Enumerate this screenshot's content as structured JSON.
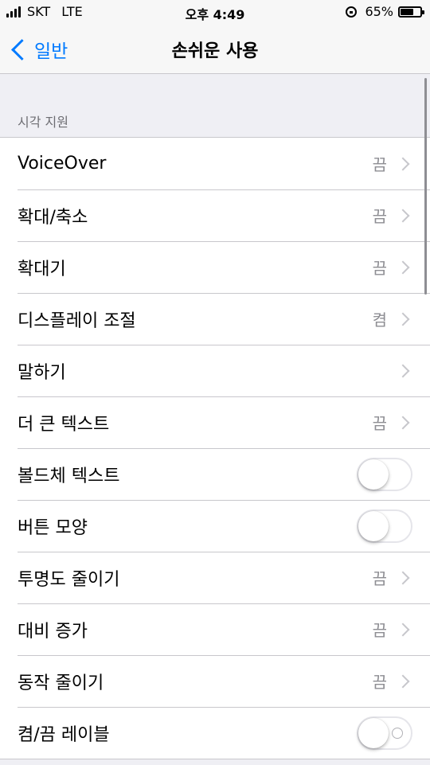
{
  "status_bar": {
    "carrier": "SKT",
    "network": "LTE",
    "time": "오후 4:49",
    "battery_percent": "65%",
    "battery_level": 0.65
  },
  "nav": {
    "back_label": "일반",
    "title": "손쉬운 사용"
  },
  "section": {
    "header": "시각 지원"
  },
  "rows": [
    {
      "label": "VoiceOver",
      "value": "끔"
    },
    {
      "label": "확대/축소",
      "value": "끔"
    },
    {
      "label": "확대기",
      "value": "끔"
    },
    {
      "label": "디스플레이 조절",
      "value": "켬"
    },
    {
      "label": "말하기",
      "value": ""
    },
    {
      "label": "더 큰 텍스트",
      "value": "끔"
    },
    {
      "label": "볼드체 텍스트",
      "toggle": false
    },
    {
      "label": "버튼 모양",
      "toggle": false
    },
    {
      "label": "투명도 줄이기",
      "value": "끔"
    },
    {
      "label": "대비 증가",
      "value": "끔"
    },
    {
      "label": "동작 줄이기",
      "value": "끔"
    },
    {
      "label": "켬/끔 레이블",
      "toggle": false
    }
  ],
  "colors": {
    "accent": "#007aff",
    "background": "#efeff4",
    "separator": "#c8c7cc",
    "secondary_text": "#8e8e93"
  }
}
